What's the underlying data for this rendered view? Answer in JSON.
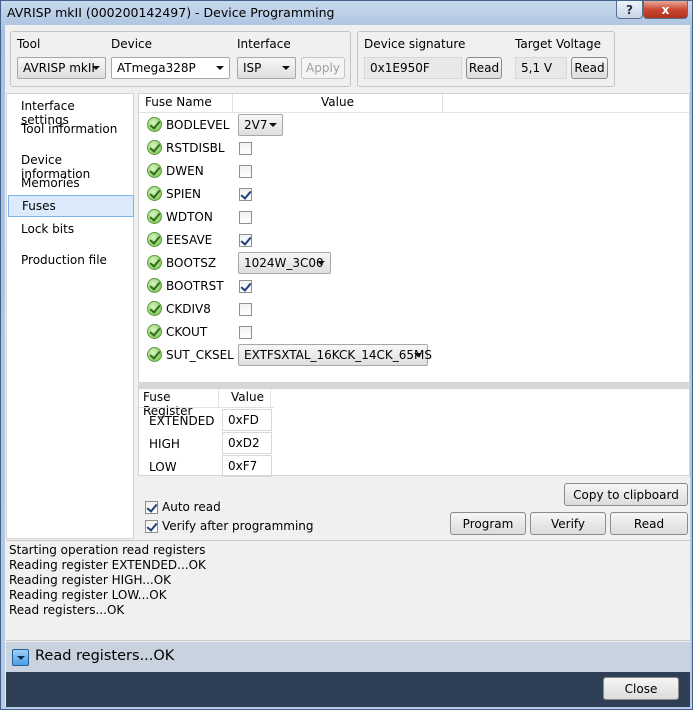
{
  "window": {
    "title": "AVRISP mkII (000200142497) - Device Programming",
    "help": "?",
    "close": "x"
  },
  "toolbar": {
    "tool_label": "Tool",
    "tool_value": "AVRISP mkII",
    "device_label": "Device",
    "device_value": "ATmega328P",
    "interface_label": "Interface",
    "interface_value": "ISP",
    "apply_label": "Apply",
    "signature_label": "Device signature",
    "signature_value": "0x1E950F",
    "signature_read": "Read",
    "voltage_label": "Target Voltage",
    "voltage_value": "5,1 V",
    "voltage_read": "Read"
  },
  "nav": [
    {
      "label": "Interface settings",
      "selected": false
    },
    {
      "label": "Tool information",
      "selected": false
    },
    {
      "label": "Device information",
      "selected": false
    },
    {
      "label": "Memories",
      "selected": false
    },
    {
      "label": "Fuses",
      "selected": true
    },
    {
      "label": "Lock bits",
      "selected": false
    },
    {
      "label": "Production file",
      "selected": false
    }
  ],
  "fuses": {
    "col_name": "Fuse Name",
    "col_value": "Value",
    "rows": [
      {
        "name": "BODLEVEL",
        "kind": "combo",
        "value": "2V7"
      },
      {
        "name": "RSTDISBL",
        "kind": "check",
        "checked": false
      },
      {
        "name": "DWEN",
        "kind": "check",
        "checked": false
      },
      {
        "name": "SPIEN",
        "kind": "check",
        "checked": true
      },
      {
        "name": "WDTON",
        "kind": "check",
        "checked": false
      },
      {
        "name": "EESAVE",
        "kind": "check",
        "checked": true
      },
      {
        "name": "BOOTSZ",
        "kind": "combo",
        "value": "1024W_3C00"
      },
      {
        "name": "BOOTRST",
        "kind": "check",
        "checked": true
      },
      {
        "name": "CKDIV8",
        "kind": "check",
        "checked": false
      },
      {
        "name": "CKOUT",
        "kind": "check",
        "checked": false
      },
      {
        "name": "SUT_CKSEL",
        "kind": "combo",
        "value": "EXTFSXTAL_16KCK_14CK_65MS"
      }
    ]
  },
  "registers": {
    "col_name": "Fuse Register",
    "col_value": "Value",
    "rows": [
      {
        "name": "EXTENDED",
        "value": "0xFD"
      },
      {
        "name": "HIGH",
        "value": "0xD2"
      },
      {
        "name": "LOW",
        "value": "0xF7"
      }
    ]
  },
  "options": {
    "auto_read": "Auto read",
    "verify": "Verify after programming"
  },
  "actions": {
    "copy": "Copy to clipboard",
    "program": "Program",
    "verify": "Verify",
    "read": "Read"
  },
  "log": [
    "Starting operation read registers",
    "Reading register EXTENDED...OK",
    "Reading register HIGH...OK",
    "Reading register LOW...OK",
    "Read registers...OK"
  ],
  "status": "Read registers...OK",
  "footer": {
    "close": "Close"
  }
}
